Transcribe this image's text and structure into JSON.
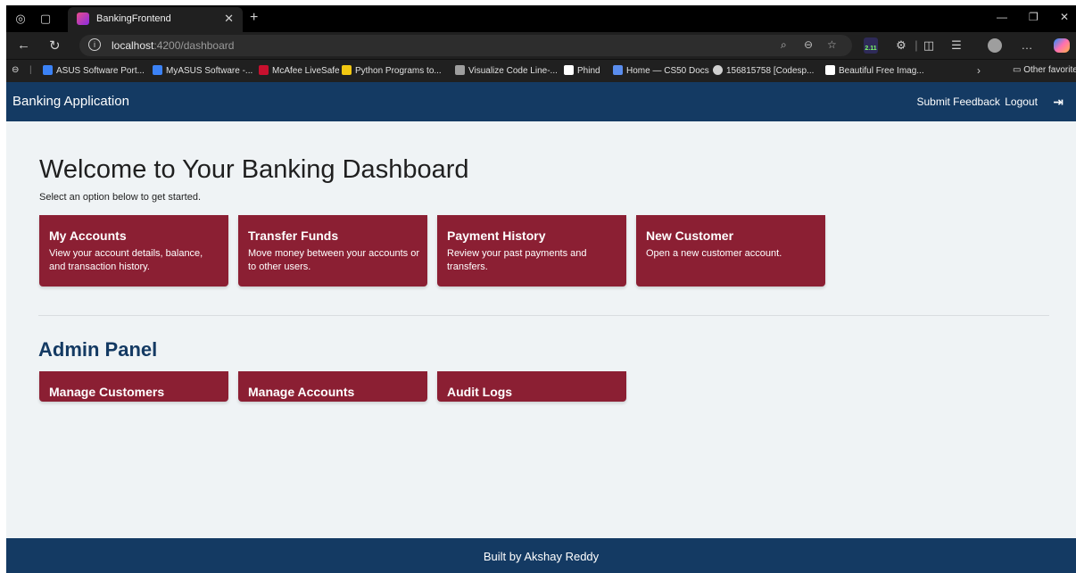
{
  "browser": {
    "tab_title": "BankingFrontend",
    "url_host": "localhost",
    "url_path": ":4200/dashboard",
    "ext_badge_text": "2.11",
    "bookmarks": [
      {
        "label": "ASUS Software Port...",
        "icon": "asus-icon",
        "color": "#3b82f6"
      },
      {
        "label": "MyASUS Software -...",
        "icon": "asus-icon",
        "color": "#3b82f6"
      },
      {
        "label": "McAfee LiveSafe",
        "icon": "mcafee-icon",
        "color": "#c8102e"
      },
      {
        "label": "Python Programs to...",
        "icon": "python-icon",
        "color": "#f2c811"
      },
      {
        "label": "Visualize Code Line-...",
        "icon": "visualize-icon",
        "color": "#9e9e9e"
      },
      {
        "label": "Phind",
        "icon": "phind-icon",
        "color": "#ffffff"
      },
      {
        "label": "Home — CS50 Docs",
        "icon": "docs-icon",
        "color": "#5a8dee"
      },
      {
        "label": "156815758 [Codesp...",
        "icon": "github-icon",
        "color": "#d0d0d0"
      },
      {
        "label": "Beautiful Free Imag...",
        "icon": "unsplash-icon",
        "color": "#ffffff"
      }
    ],
    "other_favorites": "Other favorites"
  },
  "header": {
    "brand": "Banking Application",
    "feedback_link": "Submit Feedback",
    "logout_link": "Logout"
  },
  "main": {
    "welcome_title": "Welcome to Your Banking Dashboard",
    "welcome_sub": "Select an option below to get started.",
    "cards": [
      {
        "title": "My Accounts",
        "desc": "View your account details, balance, and transaction history."
      },
      {
        "title": "Transfer Funds",
        "desc": "Move money between your accounts or to other users."
      },
      {
        "title": "Payment History",
        "desc": "Review your past payments and transfers."
      },
      {
        "title": "New Customer",
        "desc": "Open a new customer account."
      }
    ],
    "admin_title": "Admin Panel",
    "admin_cards": [
      {
        "title": "Manage Customers"
      },
      {
        "title": "Manage Accounts"
      },
      {
        "title": "Audit Logs"
      }
    ]
  },
  "footer": {
    "text": "Built by Akshay Reddy"
  },
  "colors": {
    "header_bg": "#143a63",
    "card_bg": "#8b1f33",
    "page_bg": "#eff3f5"
  }
}
